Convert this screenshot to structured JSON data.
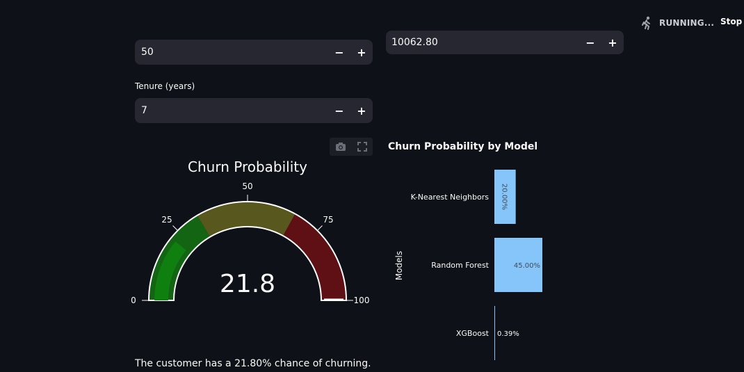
{
  "header": {
    "status_text": "RUNNING...",
    "stop_label": "Stop",
    "status_icon": "running-person-icon"
  },
  "inputs": {
    "age": {
      "value": "50",
      "minus": "−",
      "plus": "+"
    },
    "balance": {
      "value": "10062.80",
      "minus": "−",
      "plus": "+"
    },
    "tenure": {
      "label": "Tenure (years)",
      "value": "7",
      "minus": "−",
      "plus": "+"
    }
  },
  "toolbar": {
    "icons": [
      "camera-icon",
      "fullscreen-icon"
    ]
  },
  "gauge": {
    "title": "Churn Probability",
    "value": 21.8,
    "value_text": "21.8",
    "min": 0,
    "max": 100,
    "ticks": [
      "0",
      "25",
      "50",
      "75",
      "100"
    ],
    "steps": [
      {
        "range": [
          0,
          33
        ],
        "color": "#136513"
      },
      {
        "range": [
          33,
          66
        ],
        "color": "#57571e"
      },
      {
        "range": [
          66,
          100
        ],
        "color": "#5f1014"
      }
    ],
    "bar_color": "#0f800f"
  },
  "chart_data": {
    "type": "bar",
    "orientation": "horizontal",
    "title": "Churn Probability by Model",
    "ylabel": "Models",
    "xlabel": "",
    "categories": [
      "K-Nearest Neighbors",
      "Random Forest",
      "XGBoost"
    ],
    "values": [
      20.0,
      45.0,
      0.39
    ],
    "value_labels": [
      "20.00%",
      "45.00%",
      "0.39%"
    ],
    "bar_color": "#85c5f9",
    "grid": false
  },
  "conclusion": "The customer has a 21.80% chance of churning."
}
